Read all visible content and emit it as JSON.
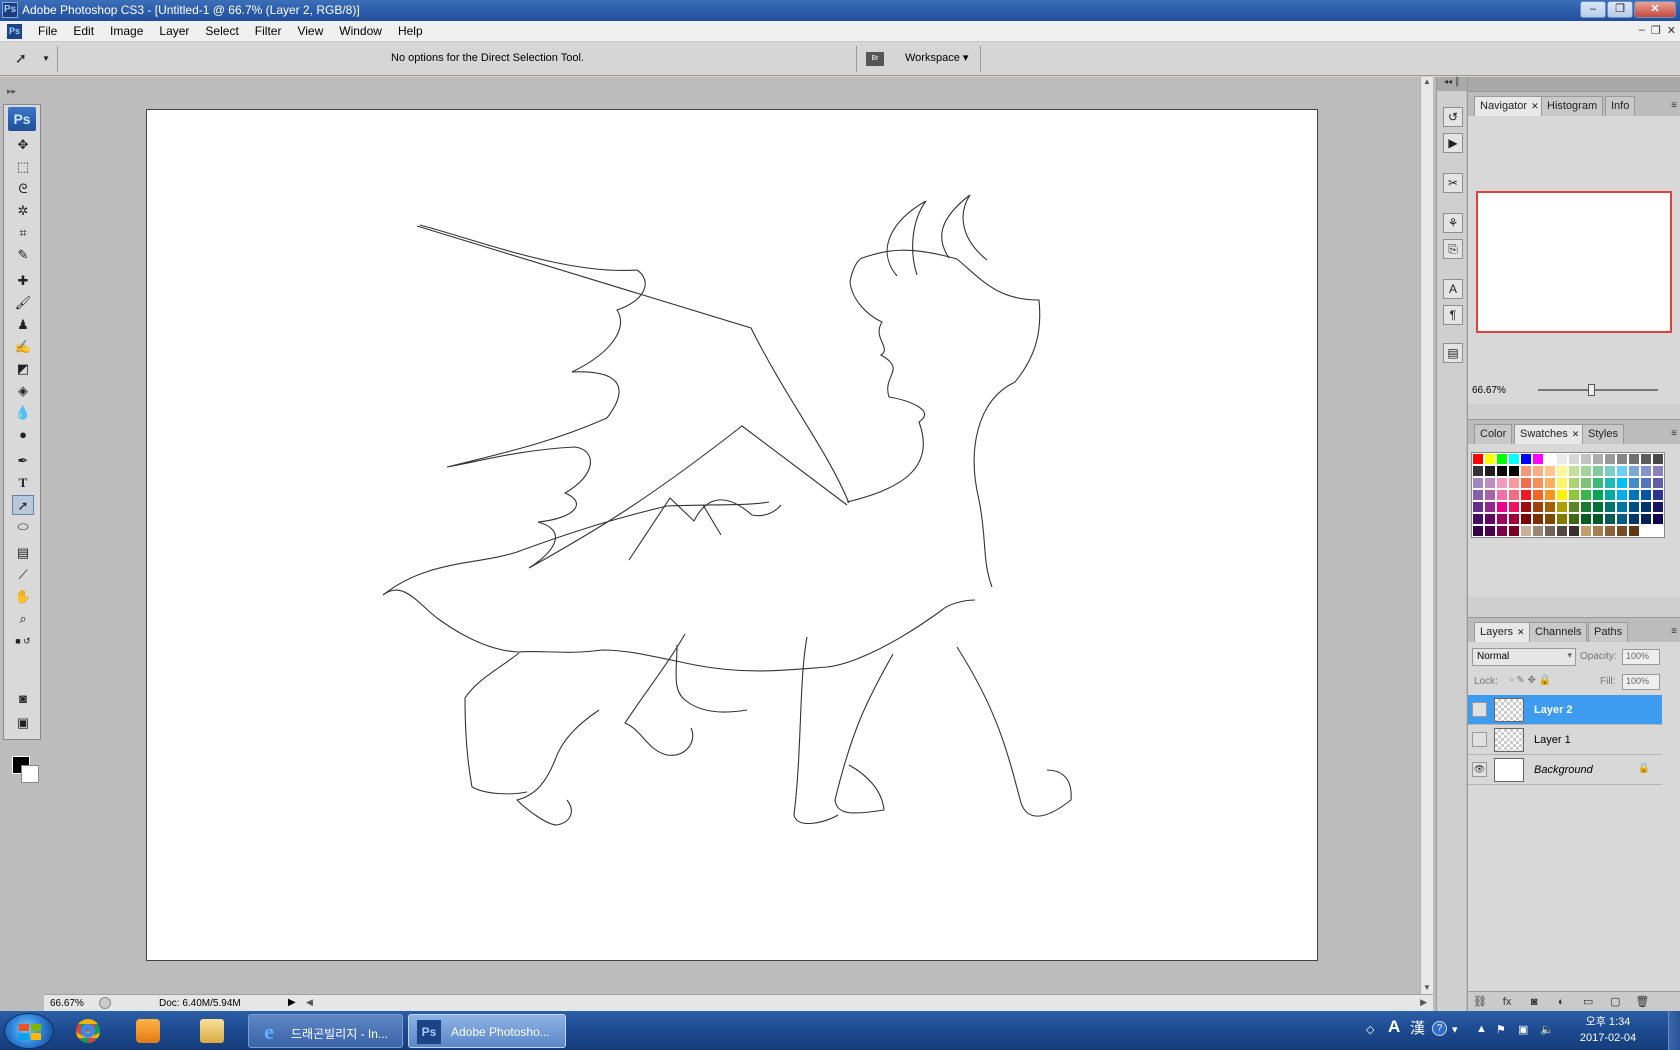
{
  "window": {
    "title": "Adobe Photoshop CS3 - [Untitled-1 @ 66.7% (Layer 2, RGB/8)]",
    "app_icon": "Ps"
  },
  "menu": [
    "File",
    "Edit",
    "Image",
    "Layer",
    "Select",
    "Filter",
    "View",
    "Window",
    "Help"
  ],
  "options_bar": {
    "message": "No options for the Direct Selection Tool.",
    "workspace_label": "Workspace ▾",
    "bridge_icon": "Br"
  },
  "toolbox": {
    "logo": "Ps",
    "active_tool": "direct-selection-tool",
    "foreground_color": "#000000",
    "background_color": "#ffffff"
  },
  "status": {
    "zoom": "66.67%",
    "doc": "Doc: 6.40M/5.94M"
  },
  "navigator": {
    "tabs": [
      "Navigator",
      "Histogram",
      "Info"
    ],
    "zoom": "66.67%",
    "view_box_color": "#d9453c"
  },
  "swatches_panel": {
    "tabs": [
      "Color",
      "Swatches",
      "Styles"
    ],
    "colors": [
      "#ff0000",
      "#ffff00",
      "#00ff00",
      "#00ffff",
      "#0000ff",
      "#ff00ff",
      "#ffffff",
      "#ebebeb",
      "#d6d6d6",
      "#c2c2c2",
      "#adadad",
      "#999999",
      "#858585",
      "#707070",
      "#5c5c5c",
      "#474747",
      "#333333",
      "#1f1f1f",
      "#0a0a0a",
      "#000000",
      "#f7977a",
      "#f9ad81",
      "#fdc68a",
      "#fff79a",
      "#c4df9b",
      "#a3d39c",
      "#82ca9d",
      "#7bcdc8",
      "#6ecff6",
      "#7ea7d8",
      "#8493ca",
      "#8882be",
      "#a187be",
      "#bc8dbf",
      "#f49ac2",
      "#f6989d",
      "#f26c4f",
      "#f68e55",
      "#fbaf5c",
      "#fff467",
      "#acd372",
      "#7cc576",
      "#3bb878",
      "#1abbb4",
      "#00bff3",
      "#438ccb",
      "#5574b9",
      "#605ca8",
      "#8560a8",
      "#a763a8",
      "#f06ea9",
      "#f26d7d",
      "#ed1c24",
      "#f26522",
      "#f7941d",
      "#fff200",
      "#8dc73f",
      "#39b54a",
      "#00a651",
      "#00a99d",
      "#00aeef",
      "#0072bc",
      "#0054a6",
      "#2e3192",
      "#662d91",
      "#92278f",
      "#ec008c",
      "#ed145b",
      "#9e0b0f",
      "#a0410d",
      "#a36209",
      "#aba000",
      "#598527",
      "#1a7b30",
      "#007236",
      "#00746b",
      "#0076a3",
      "#004b80",
      "#003471",
      "#1b1464",
      "#440e62",
      "#630460",
      "#9e005d",
      "#9e0039",
      "#790000",
      "#7b2e00",
      "#7d4900",
      "#827b00",
      "#406618",
      "#005e20",
      "#005826",
      "#005952",
      "#005b7f",
      "#003663",
      "#002157",
      "#0d004c",
      "#32004b",
      "#4b0049",
      "#7b0046",
      "#7a0026",
      "#c7b299",
      "#998675",
      "#736357",
      "#534741",
      "#37302d",
      "#c69c6d",
      "#a67c52",
      "#8c6239",
      "#754c24",
      "#603913"
    ]
  },
  "layers_panel": {
    "tabs": [
      "Layers",
      "Channels",
      "Paths"
    ],
    "blend_mode": "Normal",
    "opacity_label": "Opacity:",
    "opacity": "100%",
    "lock_label": "Lock:",
    "fill_label": "Fill:",
    "fill": "100%",
    "layers": [
      {
        "name": "Layer 2",
        "selected": true
      },
      {
        "name": "Layer 1",
        "selected": false
      },
      {
        "name": "Background",
        "selected": false
      }
    ]
  },
  "taskbar": {
    "tasks": [
      {
        "label": "드래곤빌리지 - In..."
      },
      {
        "label": "Adobe Photosho..."
      }
    ],
    "ime": "A",
    "ime_mode": "漢",
    "clock_time": "오후 1:34",
    "clock_date": "2017-02-04"
  }
}
